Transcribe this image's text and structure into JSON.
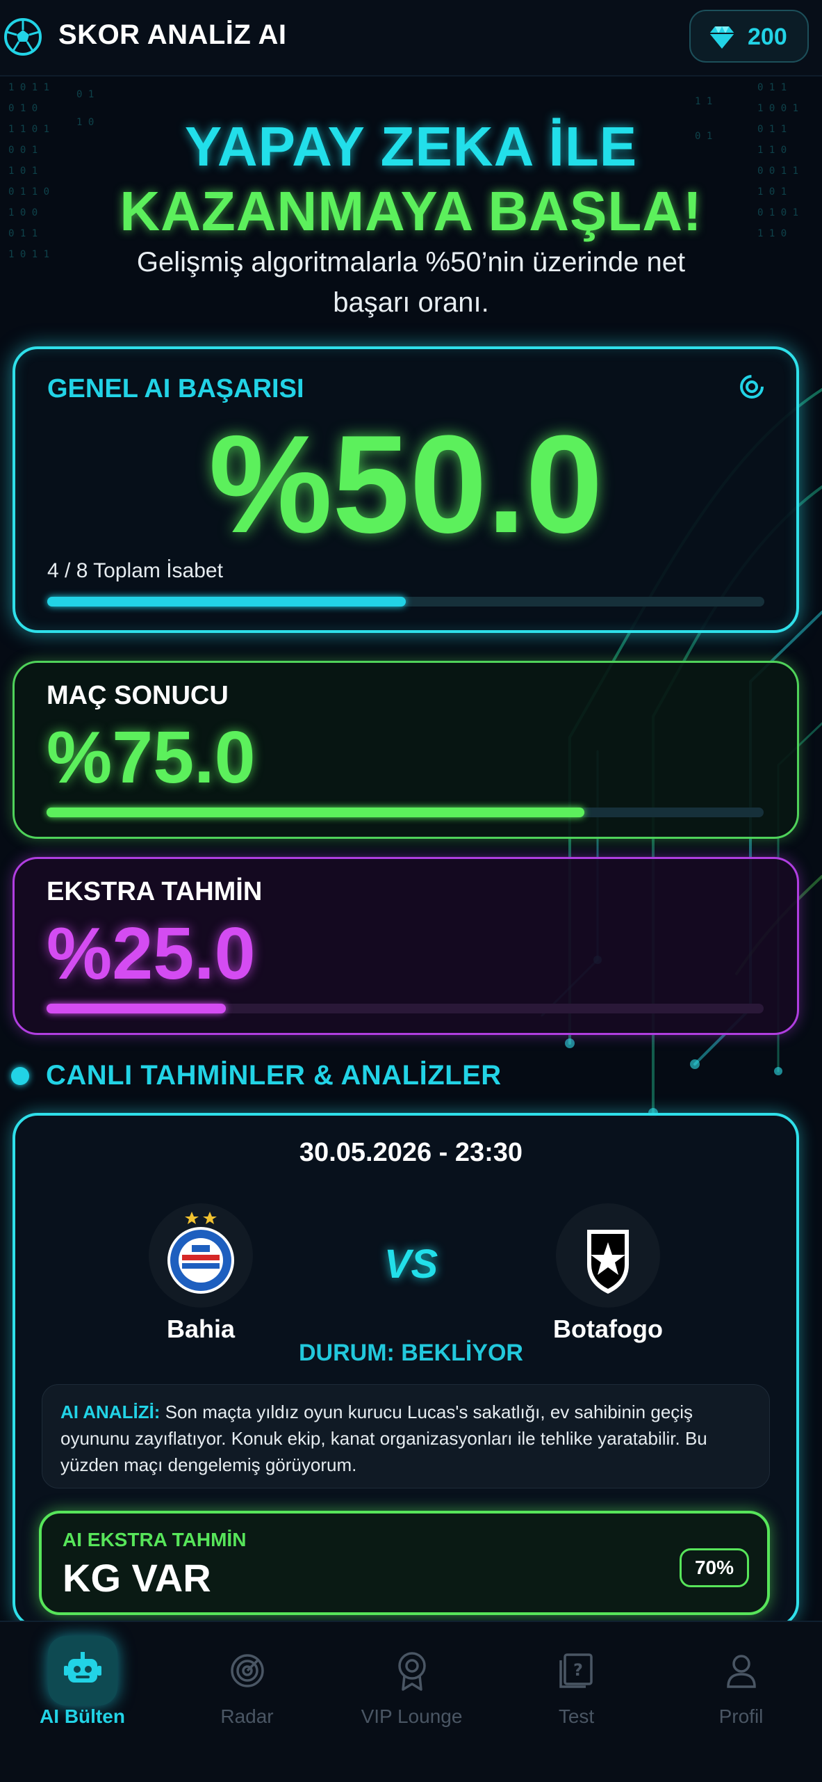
{
  "header": {
    "title": "SKOR ANALİZ AI",
    "gems": "200"
  },
  "hero": {
    "line1": "YAPAY ZEKA İLE",
    "line2": "KAZANMAYA BAŞLA!",
    "subtitle": "Gelişmiş algoritmalarla %50’nin üzerinde net başarı oranı."
  },
  "general": {
    "label": "GENEL AI BAŞARISI",
    "value": "%50.0",
    "hits": "4 / 8 Toplam İsabet",
    "progress": 0.5
  },
  "match_result": {
    "label": "MAÇ SONUCU",
    "value": "%75.0",
    "progress": 0.75
  },
  "extra_prediction": {
    "label": "EKSTRA TAHMİN",
    "value": "%25.0",
    "progress": 0.25
  },
  "section": {
    "title": "CANLI TAHMİNLER & ANALİZLER"
  },
  "match": {
    "datetime": "30.05.2026 - 23:30",
    "home": "Bahia",
    "away": "Botafogo",
    "vs": "VS",
    "status": "DURUM: BEKLİYOR",
    "analysis_label": "AI ANALİZİ:",
    "analysis_text": "Son maçta yıldız oyun kurucu Lucas's sakatlığı, ev sahibinin geçiş oyununu zayıflatıyor. Konuk ekip, kanat organizasyonları ile tehlike yaratabilir. Bu yüzden maçı dengelemiş görüyorum.",
    "extra_label": "AI EKSTRA TAHMİN",
    "extra_value": "KG VAR",
    "extra_confidence": "70%"
  },
  "nav": {
    "items": [
      {
        "label": "AI Bülten",
        "icon": "robot-icon",
        "active": true
      },
      {
        "label": "Radar",
        "icon": "radar-icon",
        "active": false
      },
      {
        "label": "VIP Lounge",
        "icon": "award-icon",
        "active": false
      },
      {
        "label": "Test",
        "icon": "question-board-icon",
        "active": false
      },
      {
        "label": "Profil",
        "icon": "user-icon",
        "active": false
      }
    ]
  },
  "colors": {
    "cyan": "#22d3e6",
    "green": "#5cf05c",
    "purple": "#d44cf2",
    "background": "#050b14"
  }
}
